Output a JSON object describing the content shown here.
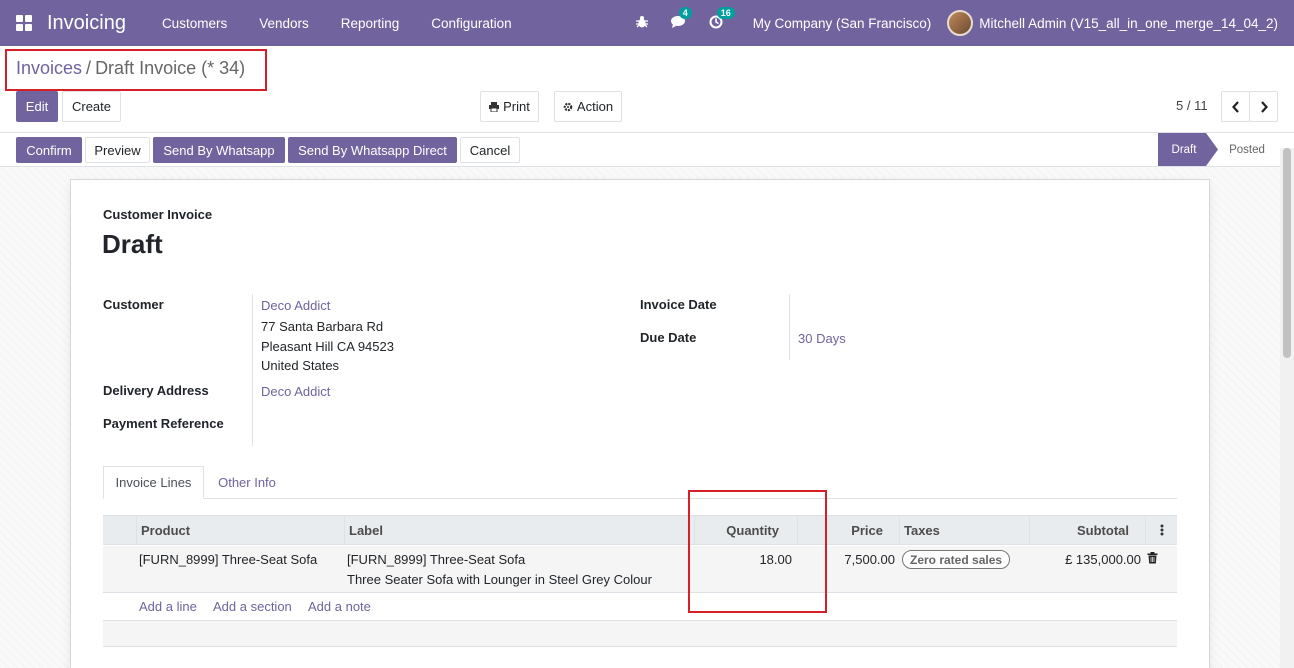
{
  "navbar": {
    "app_name": "Invoicing",
    "menu": [
      "Customers",
      "Vendors",
      "Reporting",
      "Configuration"
    ],
    "messages_count": "4",
    "activities_count": "16",
    "company": "My Company (San Francisco)",
    "user": "Mitchell Admin (V15_all_in_one_merge_14_04_2)"
  },
  "breadcrumb": {
    "parent": "Invoices",
    "separator": "/",
    "current": "Draft Invoice (* 34)"
  },
  "toolbar": {
    "edit": "Edit",
    "create": "Create",
    "print": "Print",
    "action": "Action"
  },
  "pager": {
    "value": "5 / 11"
  },
  "statusbar": {
    "confirm": "Confirm",
    "preview": "Preview",
    "send_whatsapp": "Send By Whatsapp",
    "send_whatsapp_direct": "Send By Whatsapp Direct",
    "cancel": "Cancel",
    "stages": {
      "draft": "Draft",
      "posted": "Posted"
    }
  },
  "form": {
    "type": "Customer Invoice",
    "name": "Draft",
    "labels": {
      "customer": "Customer",
      "delivery_address": "Delivery Address",
      "payment_reference": "Payment Reference",
      "invoice_date": "Invoice Date",
      "due_date": "Due Date"
    },
    "customer": {
      "name": "Deco Addict",
      "line1": "77 Santa Barbara Rd",
      "line2": "Pleasant Hill CA 94523",
      "line3": "United States"
    },
    "delivery_address": "Deco Addict",
    "due_date": "30 Days"
  },
  "tabs": {
    "lines": "Invoice Lines",
    "other": "Other Info"
  },
  "table": {
    "headers": {
      "product": "Product",
      "label": "Label",
      "quantity": "Quantity",
      "price": "Price",
      "taxes": "Taxes",
      "subtotal": "Subtotal"
    },
    "rows": [
      {
        "product": "[FURN_8999] Three-Seat Sofa",
        "label_line1": "[FURN_8999] Three-Seat Sofa",
        "label_line2": "Three Seater Sofa with Lounger in Steel Grey Colour",
        "quantity": "18.00",
        "price": "7,500.00",
        "tax": "Zero rated sales",
        "subtotal": "£ 135,000.00"
      }
    ],
    "add_line": "Add a line",
    "add_section": "Add a section",
    "add_note": "Add a note"
  },
  "colors": {
    "brand": "#71639e",
    "highlight": "#d61f26",
    "badge": "#00a09d"
  }
}
